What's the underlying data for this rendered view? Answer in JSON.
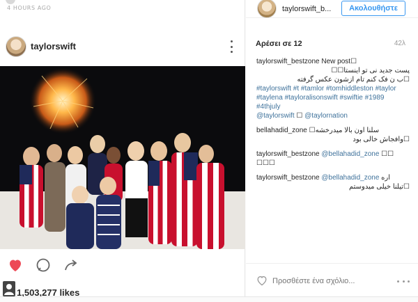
{
  "feed": {
    "time_ago": "4 HOURS AGO",
    "post": {
      "username": "taylorswift",
      "likes": "1,503,277 likes"
    }
  },
  "sidebar": {
    "username": "taylorswift_b...",
    "follow_label": "Ακολουθήστε",
    "likes_label": "Αρέσει σε",
    "likes_count": "12",
    "time": "42λ",
    "comments": [
      {
        "user": "taylorswift_bestzone",
        "text": "New post☐",
        "lines": [
          "پست جدید نی تو اینستا☐☐",
          "☐ب ن فک کنم تام ازشون عکس گرفته"
        ],
        "tags": "#taylorswift #t #tamlor #tomhiddleston #taylor #taylena #tayloralisonswift #swiftie #1989 #4thjuly",
        "mentions": [
          "@taylorswift",
          "☐",
          "@taylornation"
        ]
      },
      {
        "user": "bellahadid_zone",
        "text": "☐سلنا اون بالا میدرخشه",
        "lines": [
          "☐وافجاش خالی بود"
        ]
      },
      {
        "user": "taylorswift_bestzone",
        "mention": "@bellahadid_zone",
        "text": "☐☐",
        "lines": [
          "☐☐☐"
        ]
      },
      {
        "user": "taylorswift_bestzone",
        "mention": "@bellahadid_zone",
        "text": "اره",
        "lines": [
          "☐تیلنا خیلی میدوستم"
        ]
      }
    ],
    "comment_placeholder": "Προσθέστε ένα σχόλιο..."
  },
  "colors": {
    "accent": "#3897f0",
    "heart": "#ed4956",
    "link": "#3f729b"
  }
}
